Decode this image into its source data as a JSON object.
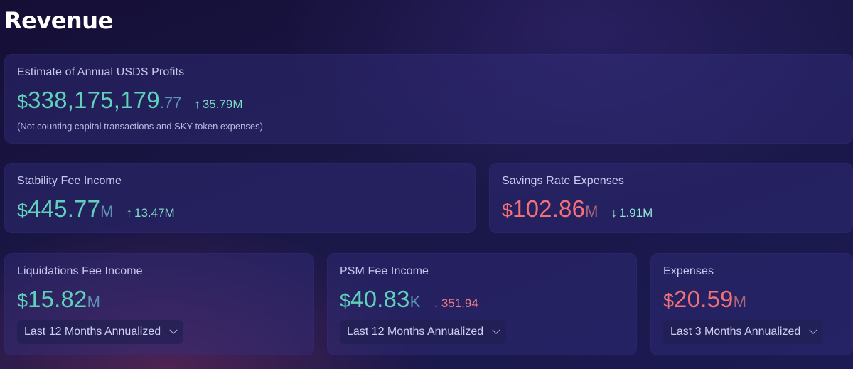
{
  "page": {
    "title": "Revenue"
  },
  "annual_profits": {
    "label": "Estimate of Annual USDS Profits",
    "currency": "$",
    "value_main": "338,175,179",
    "value_decimals": ".77",
    "change_arrow": "↑",
    "change": "35.79M",
    "note": "(Not counting capital transactions and SKY token expenses)"
  },
  "stability_fee": {
    "label": "Stability Fee Income",
    "currency": "$",
    "value": "445.77",
    "suffix": "M",
    "change_arrow": "↑",
    "change": "13.47M"
  },
  "savings_rate": {
    "label": "Savings Rate Expenses",
    "currency": "$",
    "value": "102.86",
    "suffix": "M",
    "change_arrow": "↓",
    "change": "1.91M"
  },
  "liquidations_fee": {
    "label": "Liquidations Fee Income",
    "currency": "$",
    "value": "15.82",
    "suffix": "M",
    "period": "Last 12 Months Annualized"
  },
  "psm_fee": {
    "label": "PSM Fee Income",
    "currency": "$",
    "value": "40.83",
    "suffix": "K",
    "change_arrow": "↓",
    "change": "351.94",
    "period": "Last 12 Months Annualized"
  },
  "expenses": {
    "label": "Expenses",
    "currency": "$",
    "value": "20.59",
    "suffix": "M",
    "period": "Last 3 Months Annualized"
  },
  "colors": {
    "positive": "#5fd0b9",
    "negative": "#f27078",
    "background": "#1a1746"
  }
}
